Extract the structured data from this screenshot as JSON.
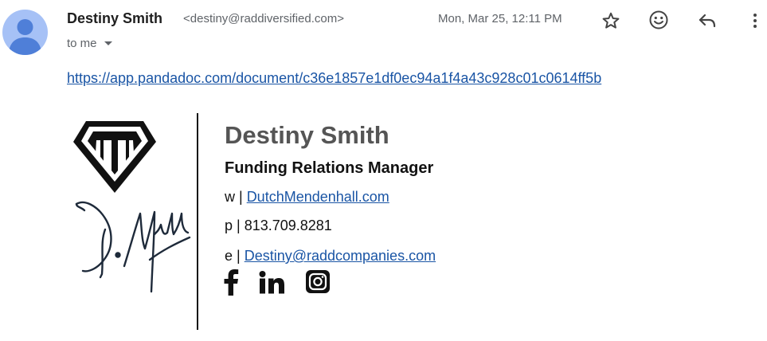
{
  "header": {
    "sender_name": "Destiny Smith",
    "sender_email": "<destiny@raddiversified.com>",
    "to_label": "to me",
    "date": "Mon, Mar 25, 12:11 PM",
    "icons": [
      "star-icon",
      "emoji-icon",
      "reply-icon",
      "more-vert-icon",
      "chevron-down-icon",
      "avatar-person-icon"
    ]
  },
  "body": {
    "link": "https://app.pandadoc.com/document/c36e1857e1df0ec94a1f4a43c928c01c0614ff5b"
  },
  "signature": {
    "name": "Destiny Smith",
    "title": "Funding Relations Manager",
    "website_prefix": "w | ",
    "website": "DutchMendenhall.com",
    "phone_prefix": "p | ",
    "phone": "813.709.8281",
    "email_prefix": "e | ",
    "email": "Destiny@raddcompanies.com",
    "social_icons": [
      "facebook-icon",
      "linkedin-icon",
      "instagram-icon"
    ]
  },
  "colors": {
    "link": "#1a55a5",
    "avatar_bg": "#a6c1f6",
    "avatar_fg": "#4f7fd8",
    "muted_text": "#5f6368",
    "signature_name": "#555555",
    "signature_mark": "#1e2a3a"
  }
}
